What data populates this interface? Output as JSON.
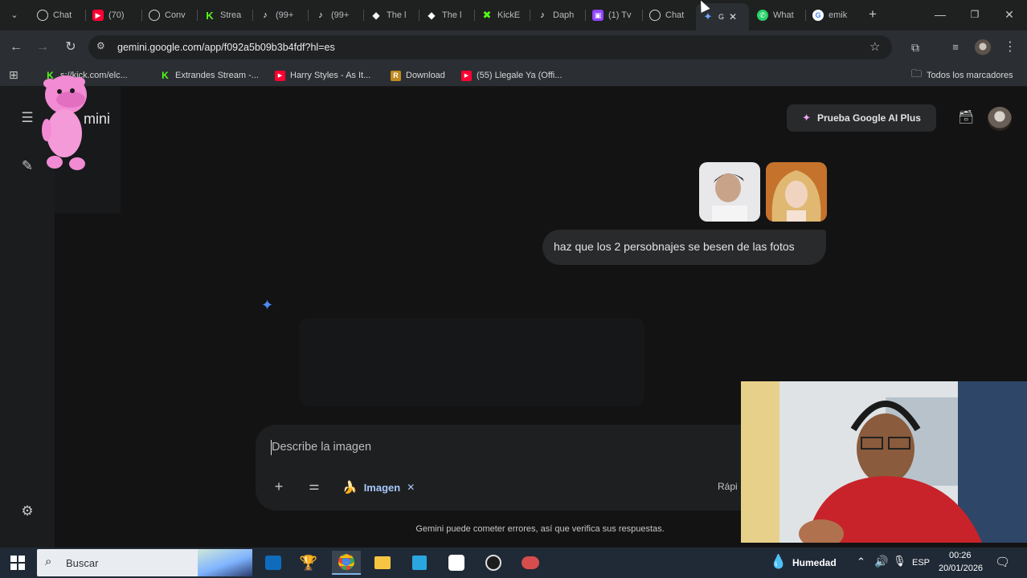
{
  "browser": {
    "tabs": [
      {
        "label": "Chat",
        "icon": "chatgpt-icon"
      },
      {
        "label": "(70)",
        "icon": "youtube-icon"
      },
      {
        "label": "Conv",
        "icon": "chatgpt-icon"
      },
      {
        "label": "Strea",
        "icon": "kick-icon"
      },
      {
        "label": "(99+",
        "icon": "tiktok-icon"
      },
      {
        "label": "(99+",
        "icon": "tiktok-icon"
      },
      {
        "label": "The l",
        "icon": "diamond-icon"
      },
      {
        "label": "The l",
        "icon": "diamond-icon"
      },
      {
        "label": "KickE",
        "icon": "kickeo-icon"
      },
      {
        "label": "Daph",
        "icon": "tiktok-icon"
      },
      {
        "label": "(1) Tv",
        "icon": "twitch-icon"
      },
      {
        "label": "Chat",
        "icon": "chatgpt-icon"
      },
      {
        "label": "G",
        "icon": "gemini-icon"
      },
      {
        "label": "What",
        "icon": "whatsapp-icon"
      },
      {
        "label": "emik",
        "icon": "google-icon"
      }
    ],
    "address": "gemini.google.com/app/f092a5b09b3b4fdf?hl=es",
    "bookmarks": [
      {
        "label": "s://kick.com/elc...",
        "icon": "kick-icon"
      },
      {
        "label": "Extrandes Stream -...",
        "icon": "kick-icon"
      },
      {
        "label": "Harry Styles - As It...",
        "icon": "youtube-icon"
      },
      {
        "label": "Download",
        "icon": "r-icon"
      },
      {
        "label": "(55) Llegale Ya (Offi...",
        "icon": "youtube-icon"
      }
    ],
    "all_bookmarks": "Todos los marcadores"
  },
  "gemini": {
    "title": "mini",
    "plus_button": "Prueba Google AI Plus",
    "user_message": "haz que los 2 persobnajes se besen de las fotos",
    "composer_placeholder": "Describe la imagen",
    "tool_chip": "Imagen",
    "mode_label": "Rápi",
    "disclaimer": "Gemini puede cometer errores, así que verifica sus respuestas."
  },
  "taskbar": {
    "search_placeholder": "Buscar",
    "weather": "Humedad",
    "language": "ESP",
    "time": "00:26",
    "date": "20/01/2026"
  },
  "colors": {
    "background": "#131314",
    "sidebar": "#1b1c1d",
    "accent_blue": "#a8c7fa",
    "taskbar": "#202a36"
  }
}
